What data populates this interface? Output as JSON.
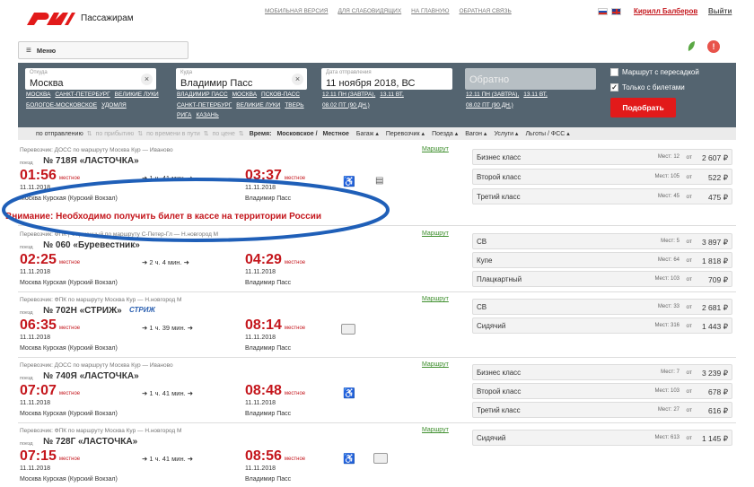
{
  "header": {
    "logo_text": "Пассажирам",
    "links": [
      "Мобильная версия",
      "Для слабовидящих",
      "На главную",
      "Обратная связь"
    ],
    "user": "Кирилл Балберов",
    "logout": "Выйти"
  },
  "menu": {
    "label": "Меню"
  },
  "search": {
    "from": {
      "caption": "Откуда",
      "value": "Москва",
      "quick": [
        "Москва",
        "Санкт-Петербург",
        "Великие Луки",
        "Бологое-Московское",
        "Удомля"
      ]
    },
    "to": {
      "caption": "Куда",
      "value": "Владимир Пасс",
      "quick": [
        "Владимир Пасс",
        "Москва",
        "Псков-Пасс",
        "Санкт-Петербург",
        "Великие Луки",
        "Тверь",
        "Рига",
        "Казань"
      ]
    },
    "date": {
      "caption": "Дата отправления",
      "value": "11 ноября 2018, ВС",
      "quick": [
        "12.11 ПН (завтра),",
        "13.11 ВТ,",
        "08.02 ПТ (90 дн.)"
      ]
    },
    "return": {
      "placeholder": "Обратно",
      "quick": [
        "12.11 ПН (завтра),",
        "13.11 ВТ,",
        "08.02 ПТ (90 дн.)"
      ]
    },
    "transfer_label": "Маршрут с пересадкой",
    "tickets_only_label": "Только с билетами",
    "find_label": "Подобрать"
  },
  "sortbar": {
    "prefix": "по отправлению",
    "options": [
      "по прибытию",
      "по времени в пути",
      "по цене"
    ],
    "time_label": "Время:",
    "time_moscow": "Московское /",
    "time_local": "Местное",
    "filters": [
      "Багаж",
      "Перевозчик",
      "Поезда",
      "Вагон",
      "Услуги",
      "Льготы / ФСС"
    ]
  },
  "route_link": "Маршрут",
  "pov_label": "поезд",
  "local_label": "местное",
  "ot_label": "от",
  "seats_label": "Мест:",
  "warning": "Внимание: Необходимо получить билет в кассе на территории России",
  "trains": [
    {
      "carrier": "Перевозчик: ДОСС    по маршруту Москва Кур — Иваново",
      "name": "№ 718Я «ЛАСТОЧКА»",
      "dep": "01:56",
      "arr": "03:37",
      "duration": "1 ч. 41 мин.",
      "dep_date": "11.11.2018",
      "arr_date": "11.11.2018",
      "dep_station": "Москва Курская (Курский Вокзал)",
      "arr_station": "Владимир Пасс",
      "fares": [
        {
          "cls": "Бизнес класс",
          "seats": "12",
          "price": "2 607 ₽"
        },
        {
          "cls": "Второй класс",
          "seats": "105",
          "price": "522 ₽"
        },
        {
          "cls": "Третий класс",
          "seats": "45",
          "price": "475 ₽"
        }
      ]
    },
    {
      "carrier": "Перевозчик: ФПК | Фирменный    по маршруту С-Петер-Гл — Н.новгород М",
      "name": "№ 060 «Буревестник»",
      "dep": "02:25",
      "arr": "04:29",
      "duration": "2 ч. 4 мин.",
      "dep_date": "11.11.2018",
      "arr_date": "11.11.2018",
      "dep_station": "Москва Курская (Курский Вокзал)",
      "arr_station": "Владимир Пасс",
      "fares": [
        {
          "cls": "СВ",
          "seats": "5",
          "price": "3 897 ₽"
        },
        {
          "cls": "Купе",
          "seats": "64",
          "price": "1 818 ₽"
        },
        {
          "cls": "Плацкартный",
          "seats": "103",
          "price": "709 ₽"
        }
      ]
    },
    {
      "carrier": "Перевозчик: ФПК    по маршруту Москва Кур — Н.новгород М",
      "name": "№ 702Н «СТРИЖ»",
      "logo": "СТРИЖ",
      "dep": "06:35",
      "arr": "08:14",
      "duration": "1 ч. 39 мин.",
      "dep_date": "11.11.2018",
      "arr_date": "11.11.2018",
      "dep_station": "Москва Курская (Курский Вокзал)",
      "arr_station": "Владимир Пасс",
      "fares": [
        {
          "cls": "СВ",
          "seats": "33",
          "price": "2 681 ₽"
        },
        {
          "cls": "Сидячий",
          "seats": "316",
          "price": "1 443 ₽"
        }
      ]
    },
    {
      "carrier": "Перевозчик: ДОСС    по маршруту Москва Кур — Иваново",
      "name": "№ 740Я «ЛАСТОЧКА»",
      "dep": "07:07",
      "arr": "08:48",
      "duration": "1 ч. 41 мин.",
      "dep_date": "11.11.2018",
      "arr_date": "11.11.2018",
      "dep_station": "Москва Курская (Курский Вокзал)",
      "arr_station": "Владимир Пасс",
      "fares": [
        {
          "cls": "Бизнес класс",
          "seats": "7",
          "price": "3 239 ₽"
        },
        {
          "cls": "Второй класс",
          "seats": "103",
          "price": "678 ₽"
        },
        {
          "cls": "Третий класс",
          "seats": "27",
          "price": "616 ₽"
        }
      ]
    },
    {
      "carrier": "Перевозчик: ФПК    по маршруту Москва Кур — Н.новгород М",
      "name": "№ 728Г «ЛАСТОЧКА»",
      "dep": "07:15",
      "arr": "08:56",
      "duration": "1 ч. 41 мин.",
      "dep_date": "11.11.2018",
      "arr_date": "11.11.2018",
      "dep_station": "Москва Курская (Курский Вокзал)",
      "arr_station": "Владимир Пасс",
      "fares": [
        {
          "cls": "Сидячий",
          "seats": "613",
          "price": "1 145 ₽"
        }
      ]
    }
  ]
}
